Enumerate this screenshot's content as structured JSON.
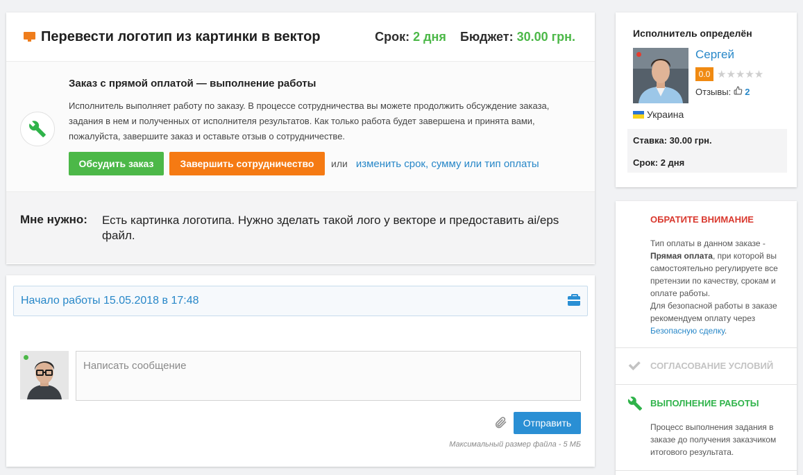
{
  "order": {
    "title": "Перевести логотип из картинки в вектор",
    "deadline_label": "Срок:",
    "deadline_value": "2 дня",
    "budget_label": "Бюджет:",
    "budget_value": "30.00 грн."
  },
  "status": {
    "title": "Заказ с прямой оплатой — выполнение работы",
    "text": "Исполнитель выполняет работу по заказу. В процессе сотрудничества вы можете продолжить обсуждение заказа, задания в нем и полученных от исполнителя результатов. Как только работа будет завершена и принята вами, пожалуйста, завершите заказ и оставьте отзыв о сотрудничестве.",
    "discuss_button": "Обсудить заказ",
    "finish_button": "Завершить сотрудничество",
    "or_text": "или",
    "change_link": "изменить срок, сумму или тип оплаты"
  },
  "need": {
    "label": "Мне нужно:",
    "text": "Есть картинка логотипа. Нужно зделать такой лого у векторе и предоставить ai/eps файл."
  },
  "chat": {
    "start_text": "Начало работы 15.05.2018 в 17:48",
    "message_placeholder": "Написать сообщение",
    "send_button": "Отправить",
    "file_note": "Максимальный размер файла - 5 МБ"
  },
  "executor": {
    "title": "Исполнитель определён",
    "name": "Сергей",
    "rating": "0.0",
    "stars": "★★★★★",
    "reviews_label": "Отзывы:",
    "reviews_count": "2",
    "country": "Украина",
    "rate": "Ставка: 30.00 грн.",
    "term": "Срок: 2 дня"
  },
  "notice": {
    "title": "ОБРАТИТЕ ВНИМАНИЕ",
    "text_1": "Тип оплаты в данном заказе - ",
    "text_bold": "Прямая оплата",
    "text_2": ", при которой вы самостоятельно регулируете все претензии по качеству, срокам и оплате работы.",
    "text_3": "Для безопасной работы в заказе рекомендуем оплату через ",
    "text_link": "Безопасную сделку",
    "text_end": "."
  },
  "steps": [
    {
      "title": "СОГЛАСОВАНИЕ УСЛОВИЙ"
    },
    {
      "title": "ВЫПОЛНЕНИЕ РАБОТЫ",
      "desc": "Процесс выполнения задания в заказе до получения заказчиком итогового результата."
    }
  ],
  "colors": {
    "green": "#4cb848",
    "orange": "#f57a13",
    "blue": "#2a8fd4",
    "link": "#2787c8",
    "red": "#d9382e"
  },
  "icons": [
    "monitor-icon",
    "wrench-icon",
    "briefcase-icon",
    "paperclip-icon",
    "thumbs-up-icon",
    "checkmark-icon",
    "flag-ukraine-icon"
  ]
}
